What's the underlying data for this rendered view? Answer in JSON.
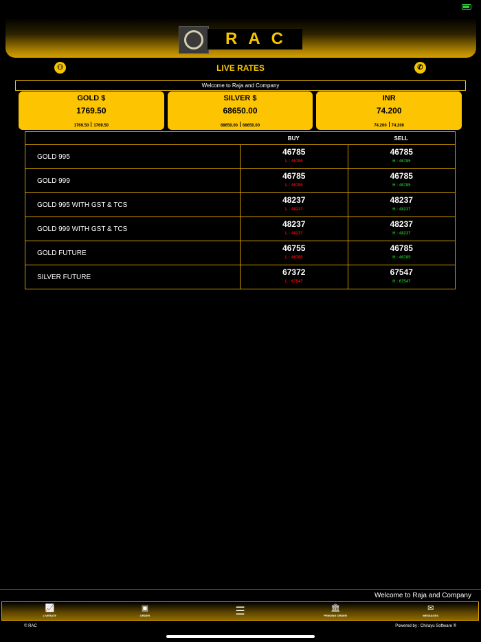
{
  "header": {
    "logo_text": "RAC"
  },
  "page_title": "LIVE RATES",
  "welcome_message": "Welcome to Raja and Company",
  "cards": [
    {
      "name": "GOLD $",
      "price": "1769.50",
      "low": "1769.50",
      "high": "1769.50"
    },
    {
      "name": "SILVER $",
      "price": "68650.00",
      "low": "68650.00",
      "high": "68650.00"
    },
    {
      "name": "INR",
      "price": "74.200",
      "low": "74.200",
      "high": "74.200"
    }
  ],
  "table": {
    "headers": {
      "buy": "BUY",
      "sell": "SELL"
    },
    "rows": [
      {
        "name": "GOLD 995",
        "buy": "46785",
        "low": "L : 46785",
        "sell": "46785",
        "high": "H : 46785"
      },
      {
        "name": "GOLD 999",
        "buy": "46785",
        "low": "L : 46785",
        "sell": "46785",
        "high": "H : 46785"
      },
      {
        "name": "GOLD 995 WITH GST & TCS",
        "buy": "48237",
        "low": "L : 48237",
        "sell": "48237",
        "high": "H : 48237"
      },
      {
        "name": "GOLD 999 WITH GST & TCS",
        "buy": "48237",
        "low": "L : 48237",
        "sell": "48237",
        "high": "H : 48237"
      },
      {
        "name": "GOLD FUTURE",
        "buy": "46755",
        "low": "L : 46785",
        "sell": "46785",
        "high": "H : 46785"
      },
      {
        "name": "SILVER FUTURE",
        "buy": "67372",
        "low": "L : 67547",
        "sell": "67547",
        "high": "H : 67547"
      }
    ]
  },
  "ticker_text": "Welcome to Raja and Company",
  "nav": {
    "liverate": "LIVERATE",
    "order": "ORDER",
    "pending_order": "PENDING ORDER",
    "messages": "MESSAGES"
  },
  "footer": {
    "copyright": "© RAC",
    "powered_by": "Powered by : Chirayu Software ®"
  },
  "colors": {
    "accent": "#fcc401",
    "low": "#e00000",
    "high": "#22a322"
  }
}
